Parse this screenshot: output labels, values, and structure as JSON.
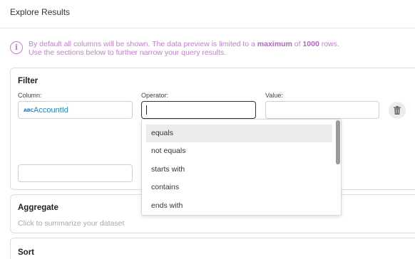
{
  "header": {
    "title": "Explore Results"
  },
  "info": {
    "icon": "info-icon",
    "line1_pre": "By default all columns will be shown. The data preview is limited to a ",
    "line1_bold1": "maximum",
    "line1_mid": " of ",
    "line1_bold2": "1000",
    "line1_post": " rows.",
    "line2": "Use the sections below to further narrow your query results."
  },
  "filter": {
    "title": "Filter",
    "column_label": "Column:",
    "column_icon": "abc-text-icon",
    "column_value": "AccountId",
    "operator_label": "Operator:",
    "operator_value": "",
    "value_label": "Value:",
    "value_value": "",
    "delete_icon": "trash-icon"
  },
  "operator_dropdown": {
    "options": [
      "equals",
      "not equals",
      "starts with",
      "contains",
      "ends with"
    ],
    "highlighted": "equals"
  },
  "aggregate": {
    "title": "Aggregate",
    "subtitle": "Click to summarize your dataset"
  },
  "sort": {
    "title": "Sort"
  },
  "colors": {
    "accent": "#c87bd6",
    "link": "#1b87c9"
  }
}
